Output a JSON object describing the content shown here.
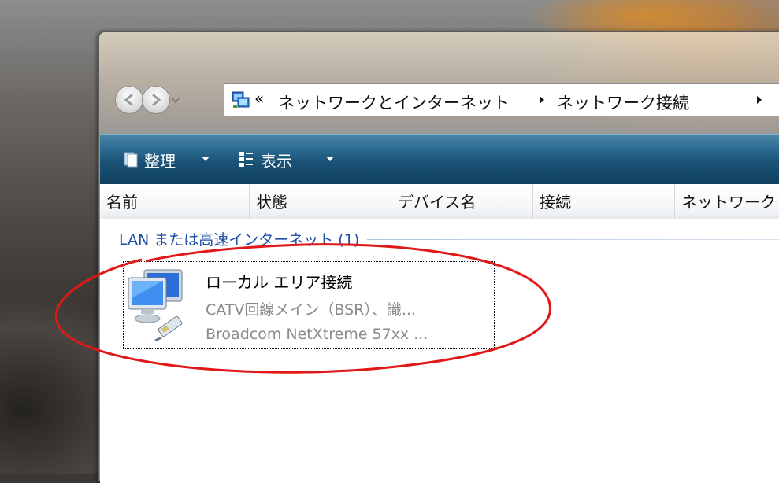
{
  "nav": {
    "back_label": "戻る",
    "forward_label": "進む"
  },
  "address": {
    "overflow_chevron": "«",
    "crumbs": [
      "ネットワークとインターネット",
      "ネットワーク接続"
    ]
  },
  "toolbar": {
    "organize_label": "整理",
    "views_label": "表示"
  },
  "columns": [
    "名前",
    "状態",
    "デバイス名",
    "接続",
    "ネットワーク"
  ],
  "group": {
    "title": "LAN または高速インターネット (1)"
  },
  "connection": {
    "name": "ローカル エリア接続",
    "status": "CATV回線メイン（BSR）、識...",
    "device": "Broadcom NetXtreme 57xx ..."
  },
  "colors": {
    "toolbar": "#1a5275",
    "group_header": "#1e4fa8",
    "annotation": "#e01818"
  }
}
